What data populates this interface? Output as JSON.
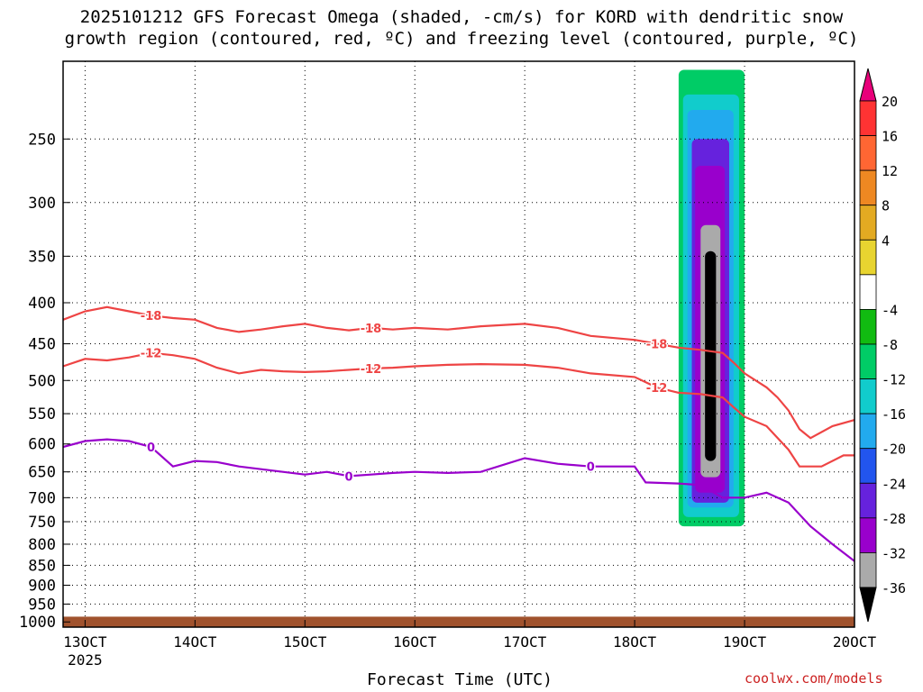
{
  "title_line1": "2025101212 GFS Forecast Omega (shaded, -cm/s) for KORD with dendritic snow",
  "title_line2": "growth region (contoured, red, ºC) and freezing level (contoured, purple, ºC)",
  "xlabel": "Forecast Time (UTC)",
  "credit": "coolwx.com/models",
  "chart_data": {
    "type": "heatmap",
    "x_ticks": [
      "13OCT",
      "14OCT",
      "15OCT",
      "16OCT",
      "17OCT",
      "18OCT",
      "19OCT",
      "20OCT"
    ],
    "x_year_label": "2025",
    "x_tick_values_day": [
      13,
      14,
      15,
      16,
      17,
      18,
      19,
      20
    ],
    "xlim_day": [
      12.8,
      20.0
    ],
    "y_ticks": [
      250,
      300,
      350,
      400,
      450,
      500,
      550,
      600,
      650,
      700,
      750,
      800,
      850,
      900,
      950,
      1000
    ],
    "ylim_hpa": [
      200,
      1015
    ],
    "y_scale": "log-pressure (reversed)",
    "grid": true,
    "colorbar": {
      "labels": [
        "20",
        "16",
        "12",
        "8",
        "4",
        "-4",
        "-8",
        "-12",
        "-16",
        "-20",
        "-24",
        "-28",
        "-32",
        "-36"
      ],
      "colors": [
        "#e8007a",
        "#ff3333",
        "#ff6633",
        "#ee8822",
        "#e3aa22",
        "#e8d430",
        "#ffffff",
        "#11bb11",
        "#00cc66",
        "#11cccc",
        "#22aaee",
        "#2255ee",
        "#6622dd",
        "#9900cc",
        "#aaaaaa",
        "#000000"
      ]
    },
    "contours": [
      {
        "label": "-18",
        "color": "#ee4444",
        "points": [
          [
            12.8,
            420
          ],
          [
            13.0,
            410
          ],
          [
            13.2,
            405
          ],
          [
            13.4,
            410
          ],
          [
            13.6,
            415
          ],
          [
            13.8,
            418
          ],
          [
            14.0,
            420
          ],
          [
            14.2,
            430
          ],
          [
            14.4,
            435
          ],
          [
            14.6,
            432
          ],
          [
            14.8,
            428
          ],
          [
            15.0,
            425
          ],
          [
            15.2,
            430
          ],
          [
            15.4,
            433
          ],
          [
            15.6,
            430
          ],
          [
            15.8,
            432
          ],
          [
            16.0,
            430
          ],
          [
            16.3,
            432
          ],
          [
            16.6,
            428
          ],
          [
            17.0,
            425
          ],
          [
            17.3,
            430
          ],
          [
            17.6,
            440
          ],
          [
            18.0,
            445
          ],
          [
            18.2,
            450
          ],
          [
            18.4,
            455
          ],
          [
            18.6,
            458
          ],
          [
            18.8,
            462
          ],
          [
            18.9,
            475
          ],
          [
            19.0,
            490
          ],
          [
            19.2,
            510
          ],
          [
            19.3,
            525
          ],
          [
            19.4,
            545
          ],
          [
            19.5,
            575
          ],
          [
            19.6,
            590
          ],
          [
            19.8,
            570
          ],
          [
            20.0,
            560
          ]
        ]
      },
      {
        "label": "-12",
        "color": "#ee4444",
        "points": [
          [
            12.8,
            480
          ],
          [
            13.0,
            470
          ],
          [
            13.2,
            472
          ],
          [
            13.4,
            468
          ],
          [
            13.6,
            462
          ],
          [
            13.8,
            465
          ],
          [
            14.0,
            470
          ],
          [
            14.2,
            482
          ],
          [
            14.4,
            490
          ],
          [
            14.6,
            485
          ],
          [
            14.8,
            487
          ],
          [
            15.0,
            488
          ],
          [
            15.2,
            487
          ],
          [
            15.4,
            485
          ],
          [
            15.6,
            483
          ],
          [
            15.8,
            482
          ],
          [
            16.0,
            480
          ],
          [
            16.3,
            478
          ],
          [
            16.6,
            477
          ],
          [
            17.0,
            478
          ],
          [
            17.3,
            482
          ],
          [
            17.6,
            490
          ],
          [
            18.0,
            495
          ],
          [
            18.2,
            510
          ],
          [
            18.4,
            518
          ],
          [
            18.6,
            520
          ],
          [
            18.8,
            525
          ],
          [
            18.9,
            540
          ],
          [
            19.0,
            555
          ],
          [
            19.2,
            570
          ],
          [
            19.4,
            610
          ],
          [
            19.5,
            640
          ],
          [
            19.7,
            640
          ],
          [
            19.9,
            620
          ],
          [
            20.0,
            620
          ]
        ]
      },
      {
        "label": "0",
        "color": "#9900cc",
        "points": [
          [
            12.8,
            605
          ],
          [
            13.0,
            595
          ],
          [
            13.2,
            592
          ],
          [
            13.4,
            595
          ],
          [
            13.6,
            605
          ],
          [
            13.8,
            640
          ],
          [
            14.0,
            630
          ],
          [
            14.2,
            632
          ],
          [
            14.4,
            640
          ],
          [
            14.6,
            645
          ],
          [
            14.8,
            650
          ],
          [
            15.0,
            655
          ],
          [
            15.2,
            650
          ],
          [
            15.4,
            658
          ],
          [
            15.6,
            655
          ],
          [
            15.8,
            652
          ],
          [
            16.0,
            650
          ],
          [
            16.3,
            652
          ],
          [
            16.6,
            650
          ],
          [
            17.0,
            625
          ],
          [
            17.3,
            635
          ],
          [
            17.6,
            640
          ],
          [
            18.0,
            640
          ],
          [
            18.1,
            670
          ],
          [
            18.4,
            672
          ],
          [
            18.6,
            675
          ],
          [
            18.8,
            700
          ],
          [
            19.0,
            700
          ],
          [
            19.2,
            690
          ],
          [
            19.4,
            710
          ],
          [
            19.6,
            760
          ],
          [
            19.8,
            800
          ],
          [
            20.0,
            840
          ]
        ]
      }
    ],
    "shaded_regions": [
      {
        "label": "-36",
        "color": "#000000",
        "x_range_day": [
          18.64,
          18.74
        ],
        "p_range_hpa": [
          345,
          630
        ]
      },
      {
        "label": "-32",
        "color": "#aaaaaa",
        "x_range_day": [
          18.6,
          18.78
        ],
        "p_range_hpa": [
          320,
          660
        ]
      },
      {
        "label": "-28",
        "color": "#9900cc",
        "x_range_day": [
          18.55,
          18.82
        ],
        "p_range_hpa": [
          270,
          690
        ]
      },
      {
        "label": "-24",
        "color": "#6622dd",
        "x_range_day": [
          18.52,
          18.86
        ],
        "p_range_hpa": [
          250,
          710
        ]
      },
      {
        "label": "-16",
        "color": "#22aaee",
        "x_range_day": [
          18.48,
          18.9
        ],
        "p_range_hpa": [
          230,
          720
        ]
      },
      {
        "label": "-12",
        "color": "#11cccc",
        "x_range_day": [
          18.44,
          18.95
        ],
        "p_range_hpa": [
          220,
          740
        ]
      },
      {
        "label": "-8",
        "color": "#00cc66",
        "x_range_day": [
          18.4,
          19.0
        ],
        "p_range_hpa": [
          205,
          760
        ]
      }
    ],
    "surface_pressure_hpa": 985
  }
}
